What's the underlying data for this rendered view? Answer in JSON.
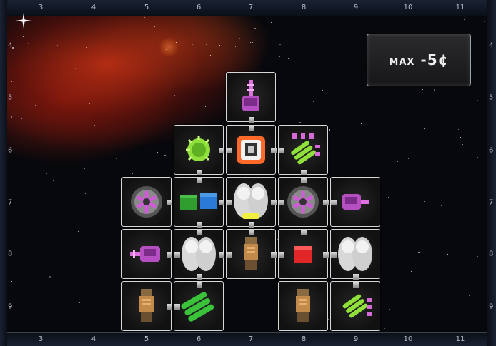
{
  "board": {
    "column_labels_top": [
      "3",
      "4",
      "5",
      "6",
      "7",
      "8",
      "9",
      "10",
      "11"
    ],
    "column_labels_bottom": [
      "3",
      "4",
      "5",
      "6",
      "7",
      "8",
      "9",
      "10",
      "11"
    ],
    "row_labels_left": [
      "4",
      "5",
      "6",
      "7",
      "8",
      "9"
    ],
    "row_labels_right": [
      "4",
      "5",
      "6",
      "7",
      "8",
      "9"
    ]
  },
  "max_label": {
    "word": "MAX",
    "value": "-5",
    "unit": "¢"
  },
  "tiles": [
    {
      "id": "laser-top",
      "type": "laser",
      "accent": "#d05ad8"
    },
    {
      "id": "shield-green",
      "type": "shield",
      "accent": "#8fe03a"
    },
    {
      "id": "cabin-center",
      "type": "main-cabin",
      "accent": "#ff6a2a"
    },
    {
      "id": "battery-upper-right",
      "type": "battery",
      "accent": "#8fe03a"
    },
    {
      "id": "engine-double",
      "type": "double-engine",
      "accent": "#c86ad8"
    },
    {
      "id": "cargo-green-blue",
      "type": "cargo",
      "accent": "#2f9e2f"
    },
    {
      "id": "cannon-center",
      "type": "double-cannon",
      "accent": "#f0f040"
    },
    {
      "id": "engine-double-right",
      "type": "double-engine",
      "accent": "#c86ad8"
    },
    {
      "id": "laser-right",
      "type": "laser",
      "accent": "#d05ad8"
    },
    {
      "id": "laser-left-low",
      "type": "laser",
      "accent": "#d05ad8"
    },
    {
      "id": "cannon-left",
      "type": "double-cannon",
      "accent": "#e0e0e0"
    },
    {
      "id": "engine-thruster-mid",
      "type": "thruster",
      "accent": "#c28a4a"
    },
    {
      "id": "cargo-red",
      "type": "cargo",
      "accent": "#e02626"
    },
    {
      "id": "cannon-right",
      "type": "double-cannon",
      "accent": "#e0e0e0"
    },
    {
      "id": "thruster-bottom-left",
      "type": "thruster",
      "accent": "#c28a4a"
    },
    {
      "id": "battery-bottom",
      "type": "battery-large",
      "accent": "#3ac23a"
    },
    {
      "id": "thruster-bottom-right",
      "type": "thruster",
      "accent": "#c28a4a"
    },
    {
      "id": "battery-bottom-right",
      "type": "battery",
      "accent": "#8fe03a"
    }
  ]
}
